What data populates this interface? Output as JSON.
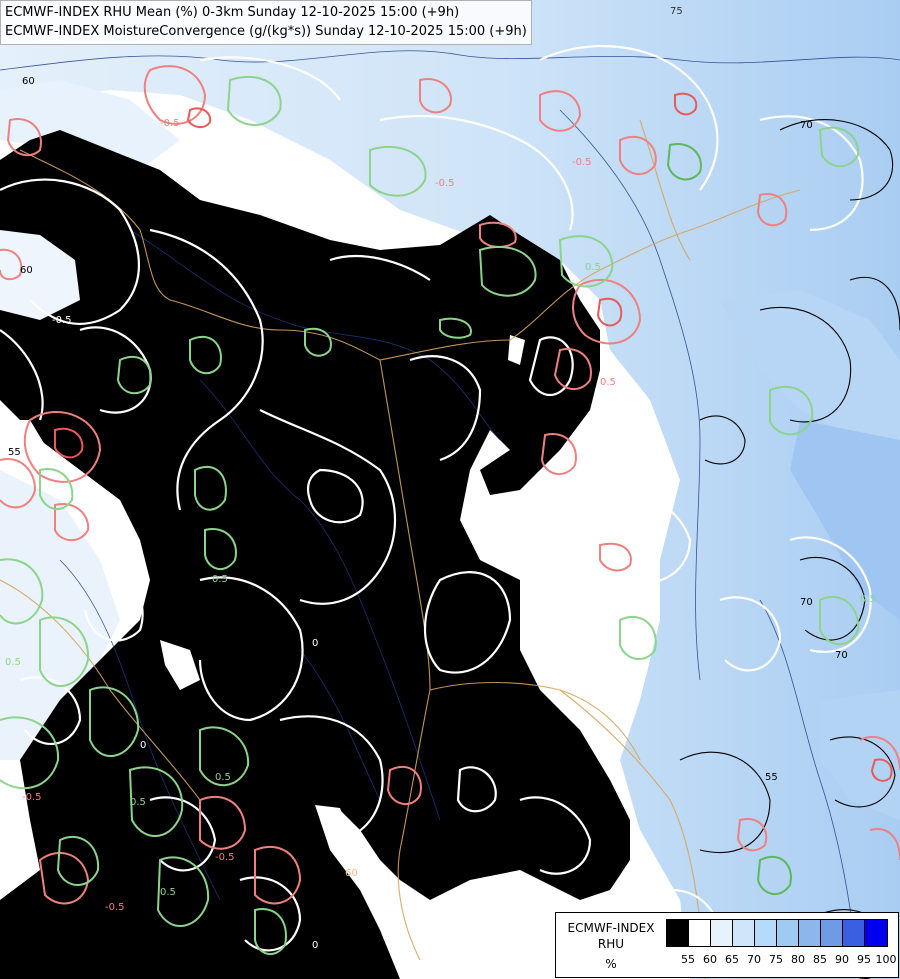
{
  "title": {
    "line1": "ECMWF-INDEX RHU Mean (%) 0-3km Sunday 12-10-2025 15:00 (+9h)",
    "line2": "ECMWF-INDEX MoistureConvergence (g/(kg*s)) Sunday 12-10-2025 15:00 (+9h)"
  },
  "legend": {
    "line1": "ECMWF-INDEX",
    "line2": "RHU",
    "unit": "%",
    "ticks": [
      "55",
      "60",
      "65",
      "70",
      "75",
      "80",
      "85",
      "90",
      "95",
      "100"
    ],
    "colors": [
      "#000000",
      "#ffffff",
      "#e6f2fc",
      "#cfe6fa",
      "#b5dbf8",
      "#9fcbf2",
      "#8db7ec",
      "#6f9be4",
      "#3a5fe0",
      "#0000ee"
    ]
  },
  "colors": {
    "rhu_white_contour": "#ffffff",
    "convergence_positive": "#f08080",
    "convergence_negative": "#8cd48c",
    "coastline": "#1e3a8a",
    "border": "#d6a45c",
    "rhu_dark_contour": "#000000"
  },
  "contour_labels": [
    "75",
    "70",
    "60",
    "60",
    "-0.5",
    "0.5",
    "-0.5",
    "0.5",
    "-0.5",
    "0.5",
    "55",
    "-0.5",
    "0",
    "0.5",
    "0.5",
    "0.5",
    "-0.5",
    "0.5",
    "0",
    "0",
    "-0.5",
    "70",
    "70",
    "55",
    "0.5",
    "-0.5",
    "60"
  ]
}
